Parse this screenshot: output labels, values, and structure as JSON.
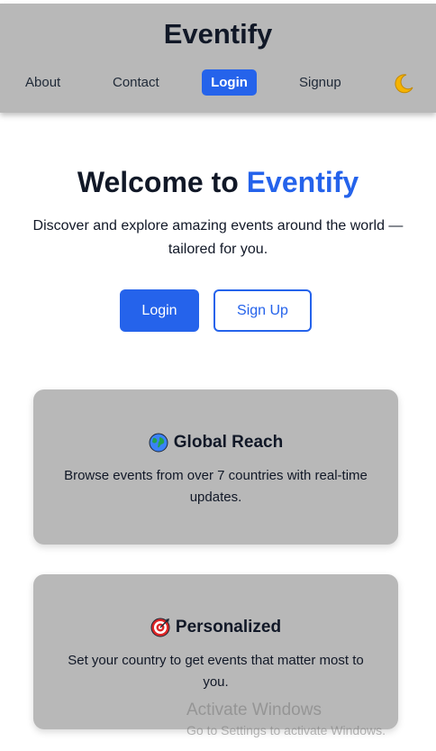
{
  "header": {
    "brand": "Eventify",
    "nav": {
      "about": "About",
      "contact": "Contact",
      "login": "Login",
      "signup": "Signup"
    },
    "theme_icon": "moon-icon"
  },
  "hero": {
    "title_prefix": "Welcome to ",
    "title_accent": "Eventify",
    "subtitle": "Discover and explore amazing events around the world — tailored for you.",
    "login_button": "Login",
    "signup_button": "Sign Up"
  },
  "features": [
    {
      "icon": "globe-icon",
      "title": "Global Reach",
      "text": "Browse events from over 7 countries with real-time updates."
    },
    {
      "icon": "target-icon",
      "title": "Personalized",
      "text": "Set your country to get events that matter most to you."
    }
  ],
  "watermark": {
    "title": "Activate Windows",
    "subtitle": "Go to Settings to activate Windows."
  },
  "colors": {
    "accent": "#2563eb",
    "header_bg": "#b8b8b8",
    "card_bg": "#b8b8b8",
    "text": "#111827"
  }
}
